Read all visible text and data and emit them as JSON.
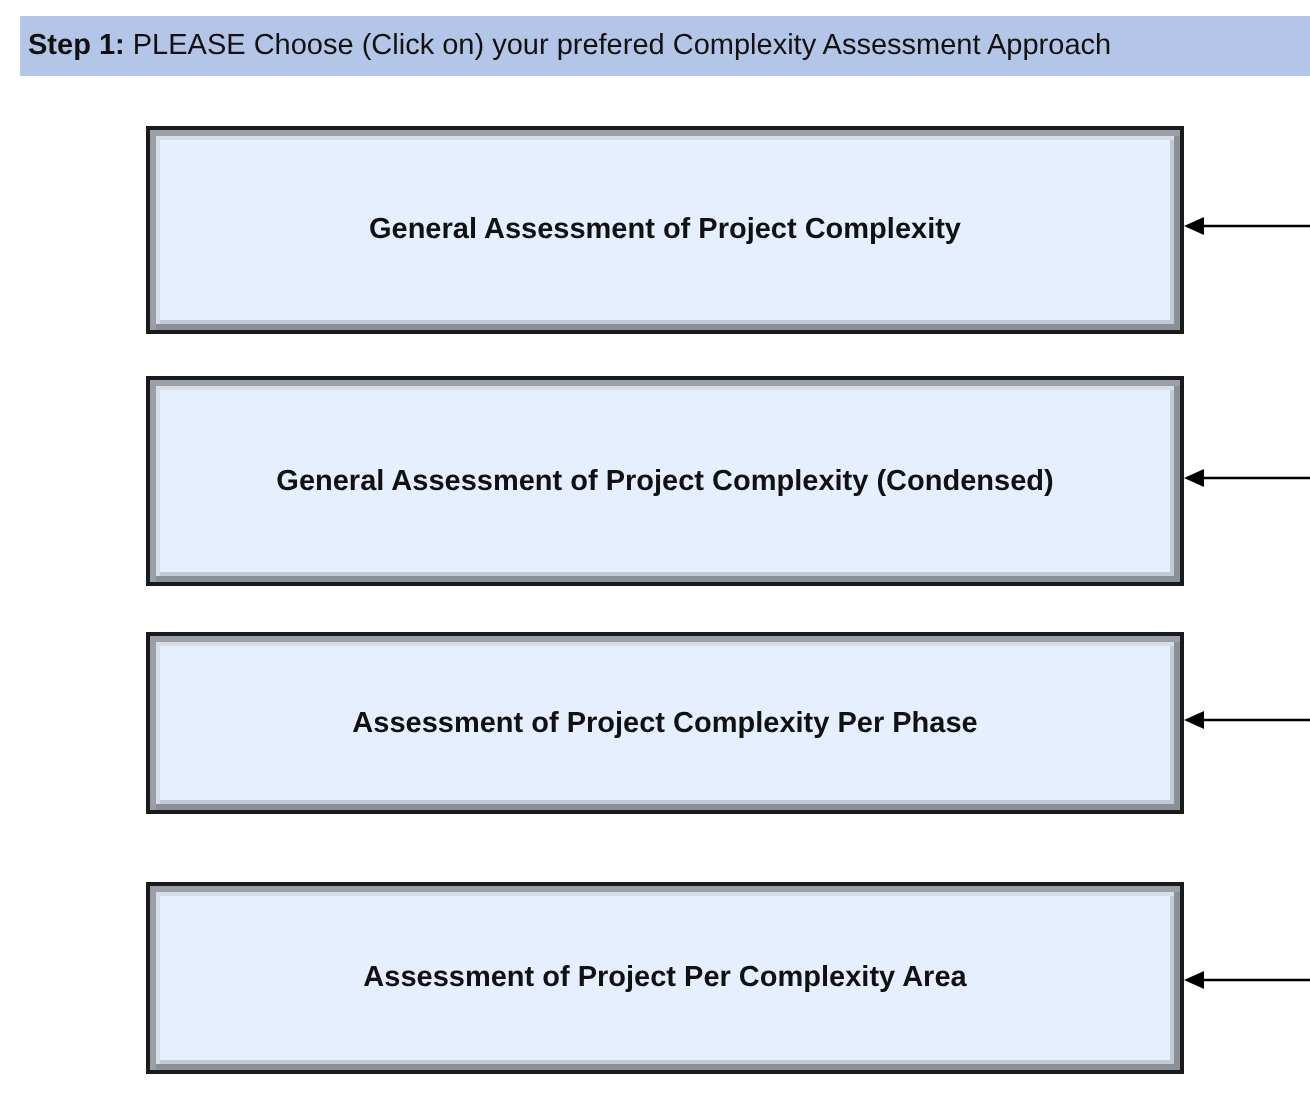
{
  "instruction": "**Step 1:** PLEASE Choose (Click on) your prefered Complexity Assessment Approach",
  "options": [
    {
      "label": "General Assessment of Project Complexity"
    },
    {
      "label": "General Assessment of Project Complexity (Condensed)"
    },
    {
      "label": "Assessment of Project Complexity Per Phase"
    },
    {
      "label": "Assessment of Project Per Complexity Area"
    }
  ]
}
